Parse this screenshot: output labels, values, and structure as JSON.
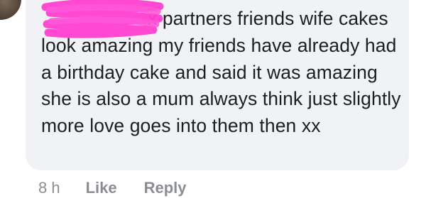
{
  "comment": {
    "text": "x partners friends wife cakes look amazing my friends have already had a birthday cake and said it was amazing she is also a mum always think just slightly more love goes into them then xx"
  },
  "actions": {
    "timestamp": "8 h",
    "like_label": "Like",
    "reply_label": "Reply"
  },
  "colors": {
    "bubble": "#f0f2f5",
    "text": "#1c1e21",
    "meta": "#8a8d91",
    "redaction": "#ff3fd0"
  }
}
